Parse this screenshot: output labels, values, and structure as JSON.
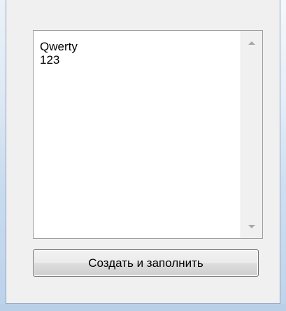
{
  "listbox": {
    "items": [
      "Qwerty",
      "123"
    ]
  },
  "scrollbar": {
    "up_icon": "scroll-up-arrow",
    "down_icon": "scroll-down-arrow"
  },
  "button": {
    "label": "Создать и заполнить"
  }
}
